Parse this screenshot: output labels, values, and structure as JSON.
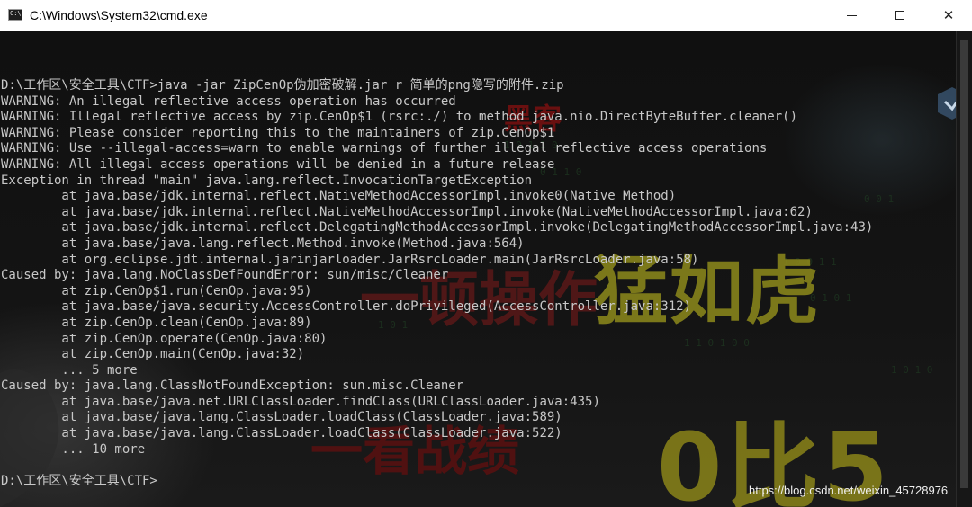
{
  "window": {
    "title": "C:\\Windows\\System32\\cmd.exe",
    "icon": "cmd-icon",
    "icon_text": "C:\\",
    "controls": {
      "minimize": "minimize-icon",
      "maximize": "maximize-icon",
      "close": "✕"
    }
  },
  "console": {
    "lines": [
      "D:\\工作区\\安全工具\\CTF>java -jar ZipCenOp伪加密破解.jar r 简单的png隐写的附件.zip",
      "WARNING: An illegal reflective access operation has occurred",
      "WARNING: Illegal reflective access by zip.CenOp$1 (rsrc:./) to method java.nio.DirectByteBuffer.cleaner()",
      "WARNING: Please consider reporting this to the maintainers of zip.CenOp$1",
      "WARNING: Use --illegal-access=warn to enable warnings of further illegal reflective access operations",
      "WARNING: All illegal access operations will be denied in a future release",
      "Exception in thread \"main\" java.lang.reflect.InvocationTargetException",
      "        at java.base/jdk.internal.reflect.NativeMethodAccessorImpl.invoke0(Native Method)",
      "        at java.base/jdk.internal.reflect.NativeMethodAccessorImpl.invoke(NativeMethodAccessorImpl.java:62)",
      "        at java.base/jdk.internal.reflect.DelegatingMethodAccessorImpl.invoke(DelegatingMethodAccessorImpl.java:43)",
      "        at java.base/java.lang.reflect.Method.invoke(Method.java:564)",
      "        at org.eclipse.jdt.internal.jarinjarloader.JarRsrcLoader.main(JarRsrcLoader.java:58)",
      "Caused by: java.lang.NoClassDefFoundError: sun/misc/Cleaner",
      "        at zip.CenOp$1.run(CenOp.java:95)",
      "        at java.base/java.security.AccessController.doPrivileged(AccessController.java:312)",
      "        at zip.CenOp.clean(CenOp.java:89)",
      "        at zip.CenOp.operate(CenOp.java:80)",
      "        at zip.CenOp.main(CenOp.java:32)",
      "        ... 5 more",
      "Caused by: java.lang.ClassNotFoundException: sun.misc.Cleaner",
      "        at java.base/java.net.URLClassLoader.findClass(URLClassLoader.java:435)",
      "        at java.base/java.lang.ClassLoader.loadClass(ClassLoader.java:589)",
      "        at java.base/java.lang.ClassLoader.loadClass(ClassLoader.java:522)",
      "        ... 10 more",
      "",
      "D:\\工作区\\安全工具\\CTF>"
    ]
  },
  "background_overlay": {
    "text_1": "黑客",
    "text_2": "一顿操作",
    "text_3": "猛如虎",
    "text_4": "一看战绩",
    "text_5": "0比5"
  },
  "watermark": "https://blog.csdn.net/weixin_45728976",
  "colors": {
    "console_bg": "#0c0c0c",
    "console_text": "#c8c8c8",
    "overlay_yellow": "#8e8a1c",
    "overlay_red": "#5a1818",
    "titlebar_bg": "#ffffff"
  }
}
